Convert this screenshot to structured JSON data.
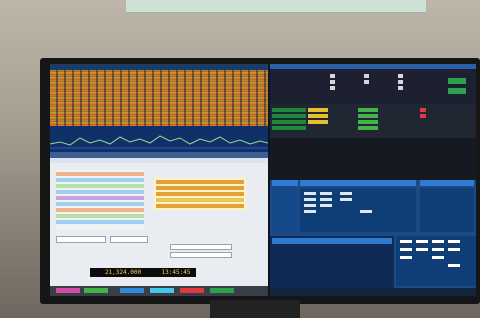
{
  "logger": {
    "frequency": "21,324.000",
    "clock": "13:45:45"
  },
  "colors": {
    "waterfall_signal": "#d4892a",
    "bandmap_spot": "#e2a036",
    "stats_panel": "#1b4a86",
    "status_green": "#2aa14a"
  },
  "icons": [
    "checkbox-icon",
    "spectrum-trace"
  ]
}
